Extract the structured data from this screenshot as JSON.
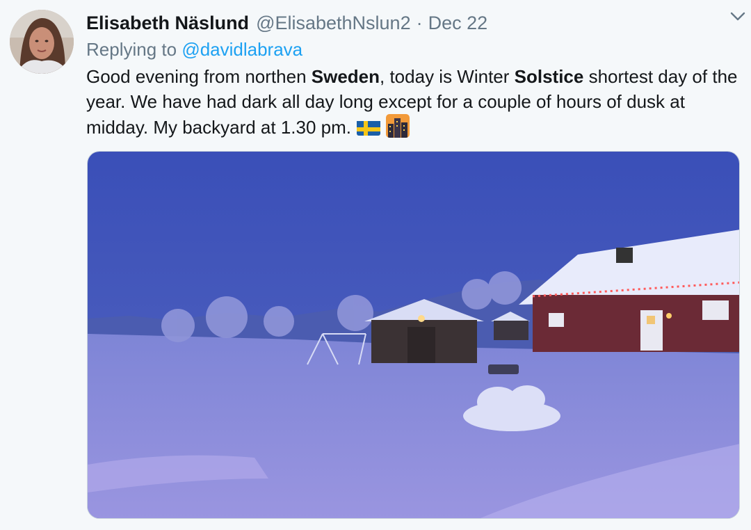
{
  "tweet": {
    "display_name": "Elisabeth Näslund",
    "handle": "@ElisabethNslun2",
    "separator": "·",
    "date": "Dec 22",
    "reply_prefix": "Replying to",
    "reply_to": "@davidlabrava",
    "text_parts": {
      "p1": "Good evening from northen ",
      "b1": "Sweden",
      "p2": ", today is Winter ",
      "b2": "Solstice",
      "p3": " shortest day of the year. We have had dark all day long except for a couple of hours of dusk at midday. My backyard at 1.30 pm."
    },
    "emojis": [
      "sweden-flag",
      "night-city"
    ],
    "caret_icon": "chevron-down-icon"
  },
  "colors": {
    "accent": "#1da1f2",
    "secondary_text": "#657786",
    "primary_text": "#14171a",
    "background": "#f5f8fa"
  }
}
